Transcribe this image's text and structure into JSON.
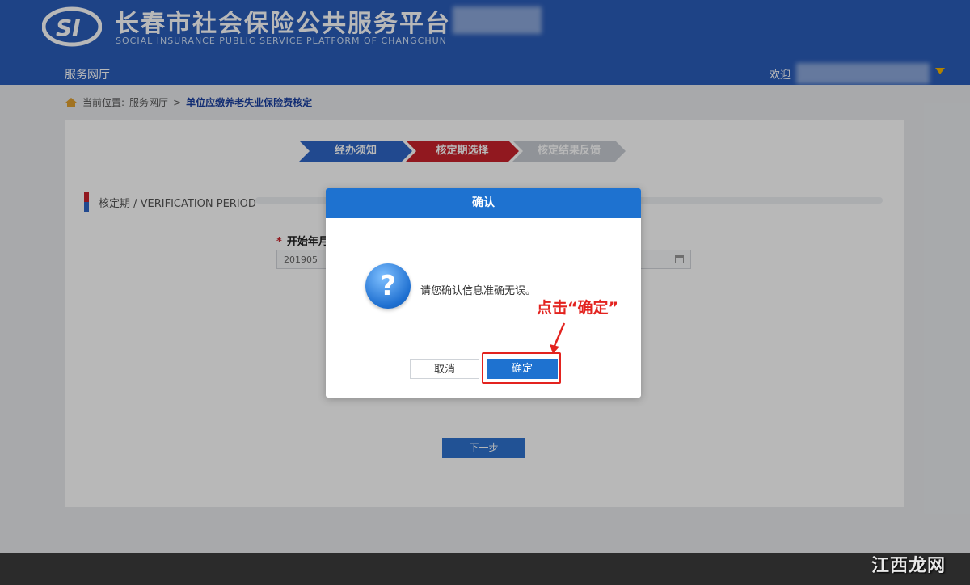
{
  "header": {
    "title": "长春市社会保险公共服务平台",
    "subtitle": "SOCIAL INSURANCE PUBLIC SERVICE PLATFORM OF CHANGCHUN",
    "nav_label": "服务网厅",
    "greeting": "欢迎"
  },
  "breadcrumb": {
    "prefix": "当前位置:",
    "home": "服务网厅",
    "separator": ">",
    "current": "单位应缴养老失业保险费核定"
  },
  "steps": [
    {
      "label": "经办须知",
      "state": "done"
    },
    {
      "label": "核定期选择",
      "state": "active"
    },
    {
      "label": "核定结果反馈",
      "state": "pending"
    }
  ],
  "section": {
    "title": "核定期 / VERIFICATION PERIOD"
  },
  "form": {
    "required_mark": "*",
    "start_label": "开始年月",
    "start_value": "201905"
  },
  "next_button": "下一步",
  "dialog": {
    "title": "确认",
    "icon": "?",
    "message": "请您确认信息准确无误。",
    "cancel": "取消",
    "ok": "确定"
  },
  "annotation": "点击“确定”",
  "watermark": "江西龙网",
  "colors": {
    "header_bg": "#2a5dba",
    "accent_blue": "#1e72d0",
    "accent_red": "#c9222b",
    "annotation_red": "#e3231f"
  }
}
